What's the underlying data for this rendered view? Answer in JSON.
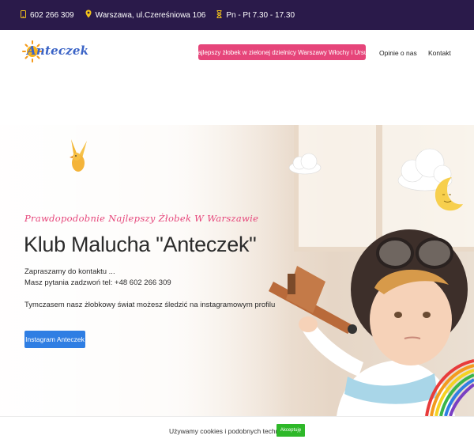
{
  "topbar": {
    "phone": "602 266 309",
    "address": "Warszawa, ul.Czereśniowa 106",
    "hours": "Pn - Pt 7.30 - 17.30"
  },
  "header": {
    "logo_text": "Anteczek",
    "highlight": "Najlepszy żłobek w zielonej dzielnicy Warszawy Włochy i Ursus",
    "nav": [
      "Opinie o nas",
      "Kontakt"
    ]
  },
  "hero": {
    "tagline": "Prawdopodobnie Najlepszy Żłobek W Warszawie",
    "title": "Klub Malucha \"Anteczek\"",
    "line1": "Zapraszamy do kontaktu ...",
    "line2": "Masz pytania zadzwoń tel: +48 602 266 309",
    "line3": "Tymczasem nasz żłobkowy świat możesz śledzić na instagramowym profilu",
    "button": "Instagram Anteczek"
  },
  "cookie": {
    "text": "Używamy cookies i podobnych technologii ...",
    "button": "Akceptuję"
  },
  "colors": {
    "topbar": "#2a1a4a",
    "accent_pink": "#e6457a",
    "button_blue": "#2f7ee3",
    "cookie_green": "#2eb829",
    "icon_yellow": "#f2c21b"
  },
  "icons": [
    "phone-icon",
    "location-pin-icon",
    "hourglass-icon"
  ]
}
